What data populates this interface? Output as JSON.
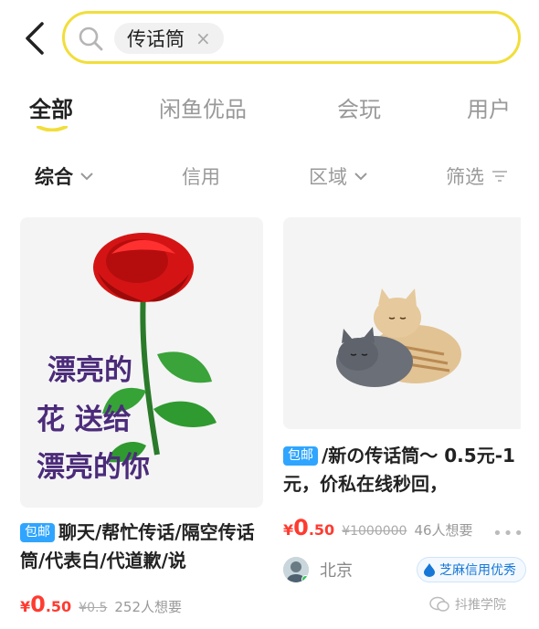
{
  "search": {
    "query": "传话筒",
    "clear_glyph": "×"
  },
  "tabs": [
    {
      "label": "全部",
      "active": true
    },
    {
      "label": "闲鱼优品",
      "active": false
    },
    {
      "label": "会玩",
      "active": false
    },
    {
      "label": "用户",
      "active": false
    }
  ],
  "sorts": [
    {
      "label": "综合",
      "active": true
    },
    {
      "label": "信用",
      "active": false
    },
    {
      "label": "区域",
      "active": false
    },
    {
      "label": "筛选",
      "active": false
    }
  ],
  "products": [
    {
      "image_text": [
        "漂亮的",
        "花 送给",
        "漂亮的你"
      ],
      "badge": "包邮",
      "title": "聊天/帮忙传话/隔空传话筒/代表白/代道歉/说",
      "currency": "¥",
      "price_int": "0",
      "price_dec": ".50",
      "old_price": "¥0.5",
      "wants": "252人想要"
    },
    {
      "badge": "包邮",
      "title": "/新の传话筒～ 0.5元-1元，价私在线秒回，",
      "currency": "¥",
      "price_int": "0",
      "price_dec": ".50",
      "old_price": "¥1000000",
      "wants": "46人想要",
      "more": "•••",
      "location": "北京",
      "credit": "芝麻信用优秀"
    }
  ],
  "watermark": "抖推学院",
  "colors": {
    "accent": "#f1de3a",
    "price": "#ff3b30",
    "badge": "#2fa5ff",
    "credit": "#1677d6"
  }
}
